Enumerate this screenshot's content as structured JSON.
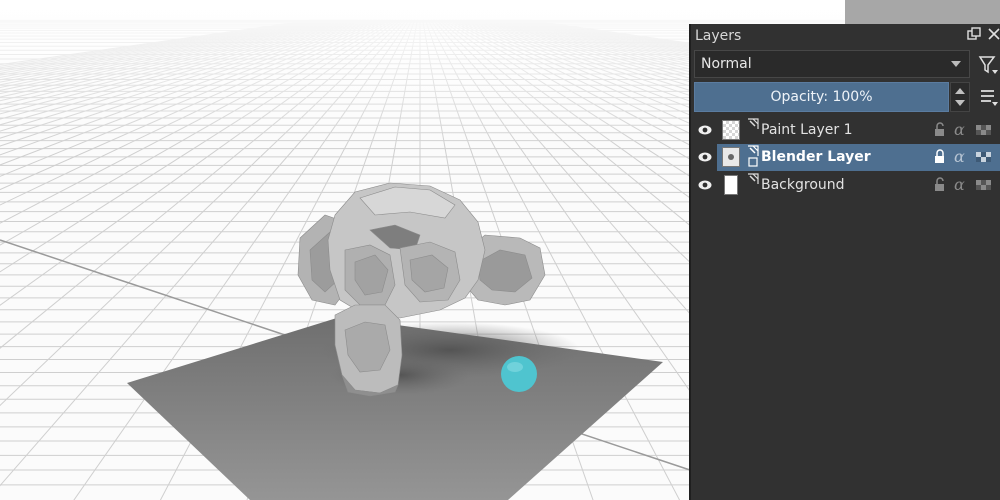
{
  "viewport": {
    "description_icon": "blender-viewport"
  },
  "layers_panel": {
    "title": "Layers",
    "float_icon": "float-window-icon",
    "close_icon": "close-icon",
    "blend_mode": "Normal",
    "filter_icon": "filter-icon",
    "opacity_label": "Opacity:  100%",
    "menu_icon": "menu-icon",
    "selected_color": "#4e6f90",
    "layers": [
      {
        "name": "Paint Layer 1",
        "thumb": "checker",
        "selected": false
      },
      {
        "name": "Blender Layer",
        "thumb": "blender",
        "selected": true
      },
      {
        "name": "Background",
        "thumb": "white",
        "selected": false
      }
    ]
  }
}
